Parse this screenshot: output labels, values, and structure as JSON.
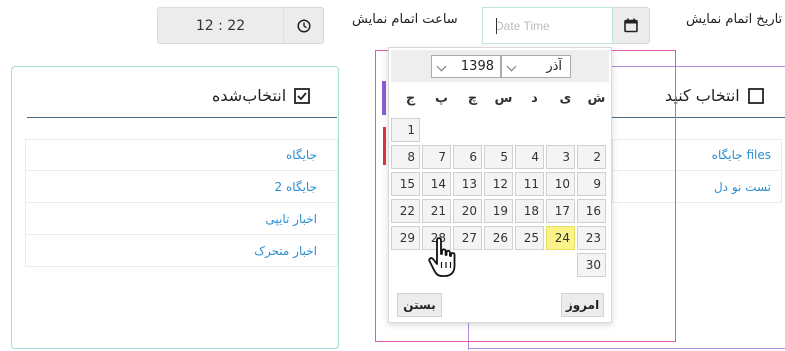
{
  "top": {
    "date_label": "تاریخ اتمام نمایش",
    "date_placeholder": "Date Time",
    "time_label": "ساعت اتمام نمایش",
    "time_value": "12 : 22"
  },
  "left_panel": {
    "title": "انتخاب‌شده",
    "items": [
      "جایگاه",
      "جایگاه 2",
      "اخبار تایپی",
      "اخبار متحرک"
    ]
  },
  "right_panel": {
    "title": "انتخاب کنید",
    "items": [
      "جایگاه files",
      "تست نو دل"
    ]
  },
  "datepicker": {
    "year": "1398",
    "month": "آذر",
    "weekdays": [
      "ش",
      "ی",
      "د",
      "س",
      "چ",
      "پ",
      "ج"
    ],
    "days": [
      "1",
      "2",
      "3",
      "4",
      "5",
      "6",
      "7",
      "8",
      "9",
      "10",
      "11",
      "12",
      "13",
      "14",
      "15",
      "16",
      "17",
      "18",
      "19",
      "20",
      "21",
      "22",
      "23",
      "24",
      "25",
      "26",
      "27",
      "28",
      "29",
      "30"
    ],
    "today": "24",
    "close_label": "بستن",
    "today_label": "امروز"
  }
}
